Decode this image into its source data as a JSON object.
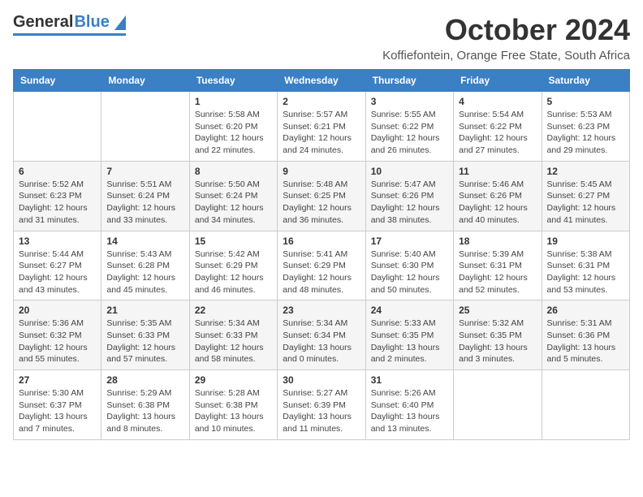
{
  "header": {
    "logo_general": "General",
    "logo_blue": "Blue",
    "month_title": "October 2024",
    "subtitle": "Koffiefontein, Orange Free State, South Africa"
  },
  "days_of_week": [
    "Sunday",
    "Monday",
    "Tuesday",
    "Wednesday",
    "Thursday",
    "Friday",
    "Saturday"
  ],
  "weeks": [
    [
      {
        "day": "",
        "sunrise": "",
        "sunset": "",
        "daylight": ""
      },
      {
        "day": "",
        "sunrise": "",
        "sunset": "",
        "daylight": ""
      },
      {
        "day": "1",
        "sunrise": "Sunrise: 5:58 AM",
        "sunset": "Sunset: 6:20 PM",
        "daylight": "Daylight: 12 hours and 22 minutes."
      },
      {
        "day": "2",
        "sunrise": "Sunrise: 5:57 AM",
        "sunset": "Sunset: 6:21 PM",
        "daylight": "Daylight: 12 hours and 24 minutes."
      },
      {
        "day": "3",
        "sunrise": "Sunrise: 5:55 AM",
        "sunset": "Sunset: 6:22 PM",
        "daylight": "Daylight: 12 hours and 26 minutes."
      },
      {
        "day": "4",
        "sunrise": "Sunrise: 5:54 AM",
        "sunset": "Sunset: 6:22 PM",
        "daylight": "Daylight: 12 hours and 27 minutes."
      },
      {
        "day": "5",
        "sunrise": "Sunrise: 5:53 AM",
        "sunset": "Sunset: 6:23 PM",
        "daylight": "Daylight: 12 hours and 29 minutes."
      }
    ],
    [
      {
        "day": "6",
        "sunrise": "Sunrise: 5:52 AM",
        "sunset": "Sunset: 6:23 PM",
        "daylight": "Daylight: 12 hours and 31 minutes."
      },
      {
        "day": "7",
        "sunrise": "Sunrise: 5:51 AM",
        "sunset": "Sunset: 6:24 PM",
        "daylight": "Daylight: 12 hours and 33 minutes."
      },
      {
        "day": "8",
        "sunrise": "Sunrise: 5:50 AM",
        "sunset": "Sunset: 6:24 PM",
        "daylight": "Daylight: 12 hours and 34 minutes."
      },
      {
        "day": "9",
        "sunrise": "Sunrise: 5:48 AM",
        "sunset": "Sunset: 6:25 PM",
        "daylight": "Daylight: 12 hours and 36 minutes."
      },
      {
        "day": "10",
        "sunrise": "Sunrise: 5:47 AM",
        "sunset": "Sunset: 6:26 PM",
        "daylight": "Daylight: 12 hours and 38 minutes."
      },
      {
        "day": "11",
        "sunrise": "Sunrise: 5:46 AM",
        "sunset": "Sunset: 6:26 PM",
        "daylight": "Daylight: 12 hours and 40 minutes."
      },
      {
        "day": "12",
        "sunrise": "Sunrise: 5:45 AM",
        "sunset": "Sunset: 6:27 PM",
        "daylight": "Daylight: 12 hours and 41 minutes."
      }
    ],
    [
      {
        "day": "13",
        "sunrise": "Sunrise: 5:44 AM",
        "sunset": "Sunset: 6:27 PM",
        "daylight": "Daylight: 12 hours and 43 minutes."
      },
      {
        "day": "14",
        "sunrise": "Sunrise: 5:43 AM",
        "sunset": "Sunset: 6:28 PM",
        "daylight": "Daylight: 12 hours and 45 minutes."
      },
      {
        "day": "15",
        "sunrise": "Sunrise: 5:42 AM",
        "sunset": "Sunset: 6:29 PM",
        "daylight": "Daylight: 12 hours and 46 minutes."
      },
      {
        "day": "16",
        "sunrise": "Sunrise: 5:41 AM",
        "sunset": "Sunset: 6:29 PM",
        "daylight": "Daylight: 12 hours and 48 minutes."
      },
      {
        "day": "17",
        "sunrise": "Sunrise: 5:40 AM",
        "sunset": "Sunset: 6:30 PM",
        "daylight": "Daylight: 12 hours and 50 minutes."
      },
      {
        "day": "18",
        "sunrise": "Sunrise: 5:39 AM",
        "sunset": "Sunset: 6:31 PM",
        "daylight": "Daylight: 12 hours and 52 minutes."
      },
      {
        "day": "19",
        "sunrise": "Sunrise: 5:38 AM",
        "sunset": "Sunset: 6:31 PM",
        "daylight": "Daylight: 12 hours and 53 minutes."
      }
    ],
    [
      {
        "day": "20",
        "sunrise": "Sunrise: 5:36 AM",
        "sunset": "Sunset: 6:32 PM",
        "daylight": "Daylight: 12 hours and 55 minutes."
      },
      {
        "day": "21",
        "sunrise": "Sunrise: 5:35 AM",
        "sunset": "Sunset: 6:33 PM",
        "daylight": "Daylight: 12 hours and 57 minutes."
      },
      {
        "day": "22",
        "sunrise": "Sunrise: 5:34 AM",
        "sunset": "Sunset: 6:33 PM",
        "daylight": "Daylight: 12 hours and 58 minutes."
      },
      {
        "day": "23",
        "sunrise": "Sunrise: 5:34 AM",
        "sunset": "Sunset: 6:34 PM",
        "daylight": "Daylight: 13 hours and 0 minutes."
      },
      {
        "day": "24",
        "sunrise": "Sunrise: 5:33 AM",
        "sunset": "Sunset: 6:35 PM",
        "daylight": "Daylight: 13 hours and 2 minutes."
      },
      {
        "day": "25",
        "sunrise": "Sunrise: 5:32 AM",
        "sunset": "Sunset: 6:35 PM",
        "daylight": "Daylight: 13 hours and 3 minutes."
      },
      {
        "day": "26",
        "sunrise": "Sunrise: 5:31 AM",
        "sunset": "Sunset: 6:36 PM",
        "daylight": "Daylight: 13 hours and 5 minutes."
      }
    ],
    [
      {
        "day": "27",
        "sunrise": "Sunrise: 5:30 AM",
        "sunset": "Sunset: 6:37 PM",
        "daylight": "Daylight: 13 hours and 7 minutes."
      },
      {
        "day": "28",
        "sunrise": "Sunrise: 5:29 AM",
        "sunset": "Sunset: 6:38 PM",
        "daylight": "Daylight: 13 hours and 8 minutes."
      },
      {
        "day": "29",
        "sunrise": "Sunrise: 5:28 AM",
        "sunset": "Sunset: 6:38 PM",
        "daylight": "Daylight: 13 hours and 10 minutes."
      },
      {
        "day": "30",
        "sunrise": "Sunrise: 5:27 AM",
        "sunset": "Sunset: 6:39 PM",
        "daylight": "Daylight: 13 hours and 11 minutes."
      },
      {
        "day": "31",
        "sunrise": "Sunrise: 5:26 AM",
        "sunset": "Sunset: 6:40 PM",
        "daylight": "Daylight: 13 hours and 13 minutes."
      },
      {
        "day": "",
        "sunrise": "",
        "sunset": "",
        "daylight": ""
      },
      {
        "day": "",
        "sunrise": "",
        "sunset": "",
        "daylight": ""
      }
    ]
  ]
}
